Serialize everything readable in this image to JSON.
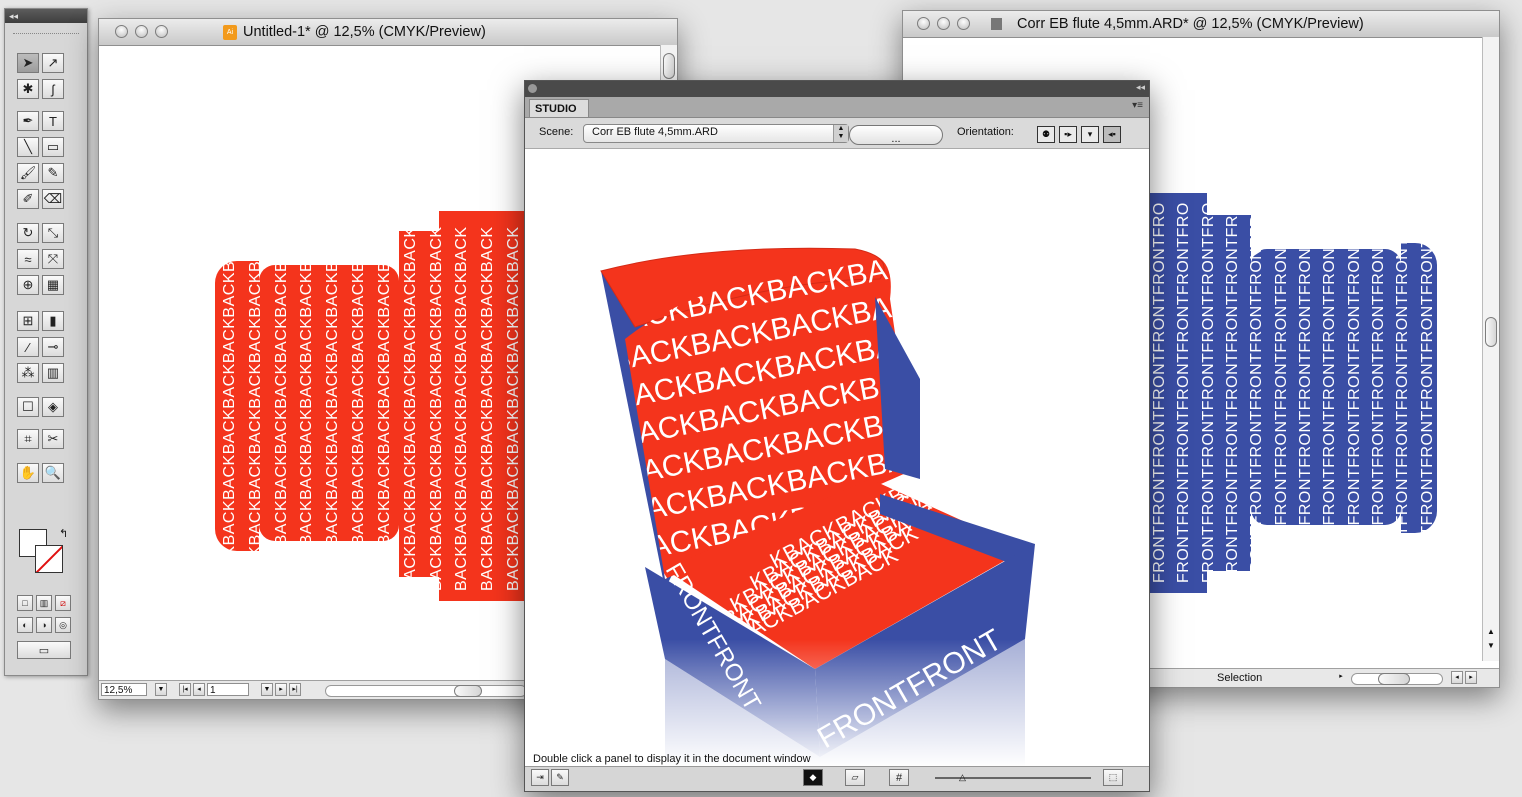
{
  "colors": {
    "red": "#f4341c",
    "blue": "#3a4ea5",
    "chrome": "#d7d7d7"
  },
  "doc1": {
    "title": "Untitled-1* @ 12,5% (CMYK/Preview)",
    "zoom": "12,5%",
    "page": "1",
    "art_word": "BACK"
  },
  "doc2": {
    "title": "Corr EB flute 4,5mm.ARD* @ 12,5% (CMYK/Preview)",
    "status": "Selection",
    "art_word": "FRONT"
  },
  "studio": {
    "tab": "STUDIO",
    "scene_label": "Scene:",
    "scene_value": "Corr EB flute 4,5mm.ARD",
    "dots_button": "...",
    "orientation_label": "Orientation:",
    "footer_text": "Double click a panel to display it in the document window",
    "art_back": "KBACKBACKBACKBACK",
    "art_front": "FRONTFRONT"
  },
  "tools": {
    "collapse": "◂◂",
    "icons": [
      "selection-icon",
      "direct-selection-icon",
      "magic-wand-icon",
      "lasso-icon",
      "pen-icon",
      "type-icon",
      "line-icon",
      "rectangle-icon",
      "paintbrush-icon",
      "pencil-icon",
      "blob-brush-icon",
      "eraser-icon",
      "rotate-icon",
      "scale-icon",
      "warp-icon",
      "free-transform-icon",
      "shape-builder-icon",
      "perspective-grid-icon",
      "mesh-icon",
      "gradient-icon",
      "eyedropper-icon",
      "blend-icon",
      "symbol-sprayer-icon",
      "graph-icon",
      "artboard-icon",
      "live-paint-icon",
      "slice-icon",
      "scissors-icon",
      "hand-icon",
      "zoom-icon"
    ]
  }
}
